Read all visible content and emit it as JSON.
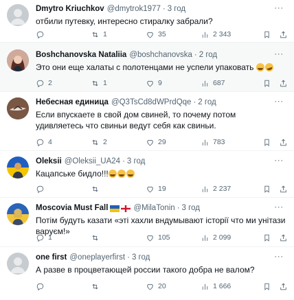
{
  "tweets": [
    {
      "name": "Dmytro Kriuchkov",
      "handle": "@dmytrok1977",
      "time": "3 год",
      "text": "отбили путевку, интересно стиралку забрали?",
      "replies": "",
      "retweets": "1",
      "likes": "35",
      "views": "2 343",
      "avatar": "gray-avatar"
    },
    {
      "name": "Boshchanovska Nataliia",
      "handle": "@boshchanovska",
      "time": "2 год",
      "text": "Это они еще халаты с полотенцами не успели упаковать",
      "replies": "2",
      "retweets": "1",
      "likes": "9",
      "views": "687",
      "avatar": "woman-photo-avatar"
    },
    {
      "name": "Небесная единица",
      "handle": "@Q3TsCd8dWPrdQqe",
      "time": "2 год",
      "text": "Если впускаете в свой дом свиней, то почему потом удивляетесь что свиньи ведут себя как свиньи.",
      "replies": "4",
      "retweets": "2",
      "likes": "29",
      "views": "783",
      "avatar": "bird-avatar"
    },
    {
      "name": "Oleksii",
      "handle": "@Oleksii_UA24",
      "time": "3 год",
      "text": "Кацапське бидло!!!",
      "replies": "",
      "retweets": "",
      "likes": "19",
      "views": "2 237",
      "avatar": "ukraine-flag-avatar"
    },
    {
      "name": "Moscovia Must Fall",
      "handle": "@MilaTonin",
      "time": "3 год",
      "text": "Потім будуть казати «эті хахли вндумывают історії что ми унітази варуєм!»",
      "replies": "1",
      "retweets": "",
      "likes": "105",
      "views": "2 099",
      "avatar": "ukraine-portrait-avatar"
    },
    {
      "name": "one first",
      "handle": "@oneplayerfirst",
      "time": "3 год",
      "text": "А разве в процветающей россии такого добра не валом?",
      "replies": "",
      "retweets": "",
      "likes": "20",
      "views": "1 666",
      "avatar": "gray-avatar"
    }
  ],
  "colors": {
    "text": "#0f1419",
    "muted": "#536471",
    "highlight_bg": "#f7f9f9",
    "divider": "#eff3f4"
  },
  "icons": [
    "reply-icon",
    "retweet-icon",
    "like-icon",
    "views-icon",
    "bookmark-icon",
    "share-icon",
    "more-icon"
  ]
}
